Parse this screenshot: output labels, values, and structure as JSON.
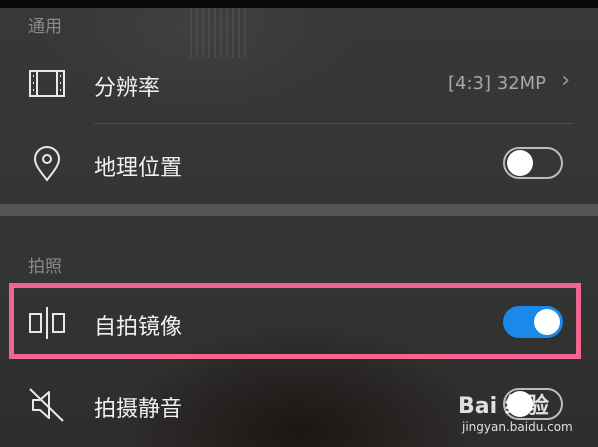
{
  "colors": {
    "accent": "#1a89ea",
    "highlight_border": "#f0668f"
  },
  "sections": {
    "general": "通用",
    "photo": "拍照"
  },
  "rows": {
    "resolution": {
      "label": "分辨率",
      "value": "[4:3] 32MP",
      "icon": "resolution-icon"
    },
    "location": {
      "label": "地理位置",
      "toggle_on": false,
      "icon": "location-pin-icon"
    },
    "mirror": {
      "label": "自拍镜像",
      "toggle_on": true,
      "icon": "mirror-icon"
    },
    "mute": {
      "label": "拍摄静音",
      "toggle_on": false,
      "icon": "speaker-muted-icon"
    }
  },
  "watermark": {
    "logo_text": "Bai 经验",
    "url": "jingyan.baidu.com"
  }
}
